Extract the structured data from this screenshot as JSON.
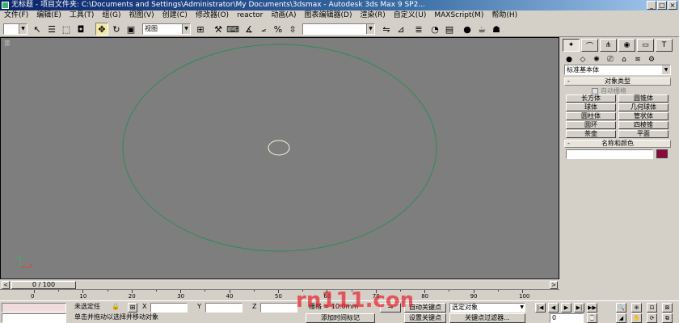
{
  "window": {
    "title": "无标题    - 项目文件夹: C:\\Documents and Settings\\Administrator\\My Documents\\3dsmax    - Autodesk 3ds Max 9 SP2...",
    "minimize": "_",
    "maximize": "□",
    "close": "×"
  },
  "menu": {
    "items": [
      "文件(F)",
      "编辑(E)",
      "工具(T)",
      "组(G)",
      "视图(V)",
      "创建(C)",
      "修改器(O)",
      "reactor",
      "动画(A)",
      "图表编辑器(D)",
      "渲染(R)",
      "自定义(U)",
      "MAXScript(M)",
      "帮助(H)"
    ]
  },
  "toolbar": {
    "selection_filter": "",
    "coord_system": "视图",
    "named_selection": ""
  },
  "viewport": {
    "label": "顶",
    "circle_color": "#2e8b57",
    "pivot_color": "#f5f5dc",
    "bg_color": "#7e7e7e"
  },
  "command_panel": {
    "category": "标准基本体",
    "object_type_title": "对象类型",
    "autogrid_label": "自动栅格",
    "objects": [
      "长方体",
      "圆锥体",
      "球体",
      "几何球体",
      "圆柱体",
      "管状体",
      "圆环",
      "四棱锥",
      "茶壶",
      "平面"
    ],
    "name_color_title": "名称和颜色",
    "name_value": "",
    "swatch_color": "#8b0a3a",
    "rollout_collapse": "-"
  },
  "timeslider": {
    "frame_display": "0 / 100",
    "prev": "<",
    "next": ">"
  },
  "ruler": {
    "labels": [
      "0",
      "10",
      "20",
      "30",
      "40",
      "50",
      "60",
      "70",
      "80",
      "90",
      "100"
    ]
  },
  "status": {
    "selection": "未选定任",
    "x_label": "X",
    "y_label": "Y",
    "z_label": "Z",
    "x_value": "",
    "y_value": "",
    "z_value": "",
    "grid": "栅格 = 10.0mm",
    "prompt": "单击并拖动以选择并移动对象",
    "add_time_tag": "添加时间标记",
    "auto_key": "自动关键点",
    "set_key": "设置关键点",
    "selected_object": "选定对象",
    "key_filters": "关键点过滤器...",
    "frame_value": "0"
  },
  "watermark": {
    "text": "rn111.com",
    "color": "#e8202a"
  }
}
